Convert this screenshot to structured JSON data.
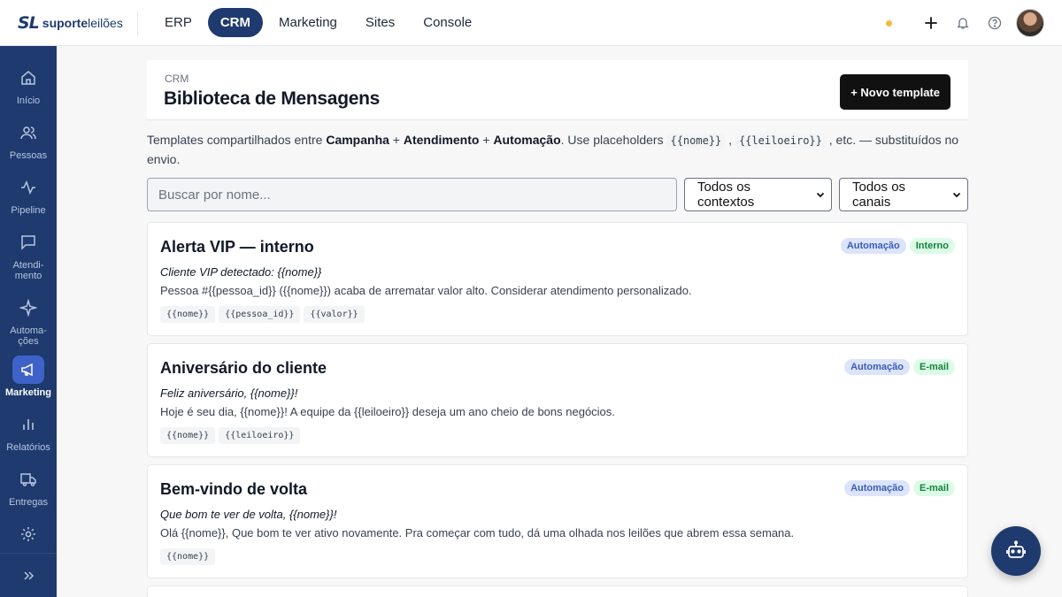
{
  "brand": {
    "mark": "SL",
    "text_bold": "suporte",
    "text_regular": "leilões"
  },
  "topnav": [
    {
      "label": "ERP",
      "active": false
    },
    {
      "label": "CRM",
      "active": true
    },
    {
      "label": "Marketing",
      "active": false
    },
    {
      "label": "Sites",
      "active": false
    },
    {
      "label": "Console",
      "active": false
    }
  ],
  "sidebar": {
    "items": [
      {
        "label": "Início",
        "icon": "home-icon"
      },
      {
        "label": "Pessoas",
        "icon": "users-icon"
      },
      {
        "label": "Pipeline",
        "icon": "activity-icon"
      },
      {
        "label": "Atendi-\nmento",
        "icon": "message-icon"
      },
      {
        "label": "Automa-\nções",
        "icon": "sparkle-icon"
      },
      {
        "label": "Marketing",
        "icon": "megaphone-icon",
        "active": true
      },
      {
        "label": "Relatórios",
        "icon": "bar-chart-icon"
      },
      {
        "label": "Entregas",
        "icon": "truck-icon"
      },
      {
        "label": "",
        "icon": "gear-icon"
      }
    ]
  },
  "header": {
    "breadcrumb": "CRM",
    "title": "Biblioteca de Mensagens",
    "new_button": "+ Novo template"
  },
  "intro": {
    "t1": "Templates compartilhados entre ",
    "b1": "Campanha",
    "t2": " + ",
    "b2": "Atendimento",
    "t3": " + ",
    "b3": "Automação",
    "t4": ". Use placeholders ",
    "ph1": "{{nome}}",
    "t5": " , ",
    "ph2": "{{leiloeiro}}",
    "t6": " , etc. — substituídos no envio."
  },
  "filters": {
    "search_placeholder": "Buscar por nome...",
    "context_select": "Todos os contextos",
    "channel_select": "Todos os canais"
  },
  "templates": [
    {
      "title": "Alerta VIP — interno",
      "badges": [
        "Automação",
        "Interno"
      ],
      "subject": "Cliente VIP detectado: {{nome}}",
      "body": "Pessoa #{{pessoa_id}} ({{nome}}) acaba de arrematar valor alto. Considerar atendimento personalizado.",
      "tags": [
        "{{nome}}",
        "{{pessoa_id}}",
        "{{valor}}"
      ]
    },
    {
      "title": "Aniversário do cliente",
      "badges": [
        "Automação",
        "E-mail"
      ],
      "subject": "Feliz aniversário, {{nome}}!",
      "body": "Hoje é seu dia, {{nome}}! A equipe da {{leiloeiro}} deseja um ano cheio de bons negócios.",
      "tags": [
        "{{nome}}",
        "{{leiloeiro}}"
      ]
    },
    {
      "title": "Bem-vindo de volta",
      "badges": [
        "Automação",
        "E-mail"
      ],
      "subject": "Que bom te ver de volta, {{nome}}!",
      "body": "Olá {{nome}}, Que bom te ver ativo novamente. Pra começar com tudo, dá uma olhada nos leilões que abrem essa semana.",
      "tags": [
        "{{nome}}"
      ]
    }
  ],
  "colors": {
    "brand": "#1e3a6e",
    "accent": "#3f62c9",
    "notification_dot": "#f5b841"
  }
}
